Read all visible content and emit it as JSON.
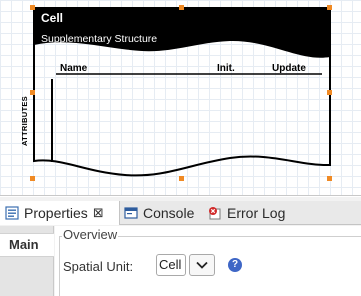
{
  "canvas": {
    "shape": {
      "title": "Cell",
      "subtitle": "Supplementary Structure",
      "columns": [
        "Name",
        "Init.",
        "Update"
      ],
      "side_label": "ATTRIBUTES"
    }
  },
  "views": {
    "tabs": [
      {
        "label": "Properties",
        "icon": "properties-icon",
        "closable": true,
        "active": true
      },
      {
        "label": "Console",
        "icon": "console-icon"
      },
      {
        "label": "Error Log",
        "icon": "error-log-icon"
      }
    ],
    "close_glyph": "⊠"
  },
  "properties": {
    "sections": [
      "Main"
    ],
    "group_title": "Overview",
    "spatial_unit_label": "Spatial Unit:",
    "spatial_unit_value": "Cell",
    "help_glyph": "?"
  },
  "colors": {
    "shape_fill": "#000000",
    "handle": "#f08a24",
    "help": "#3e66c6"
  }
}
